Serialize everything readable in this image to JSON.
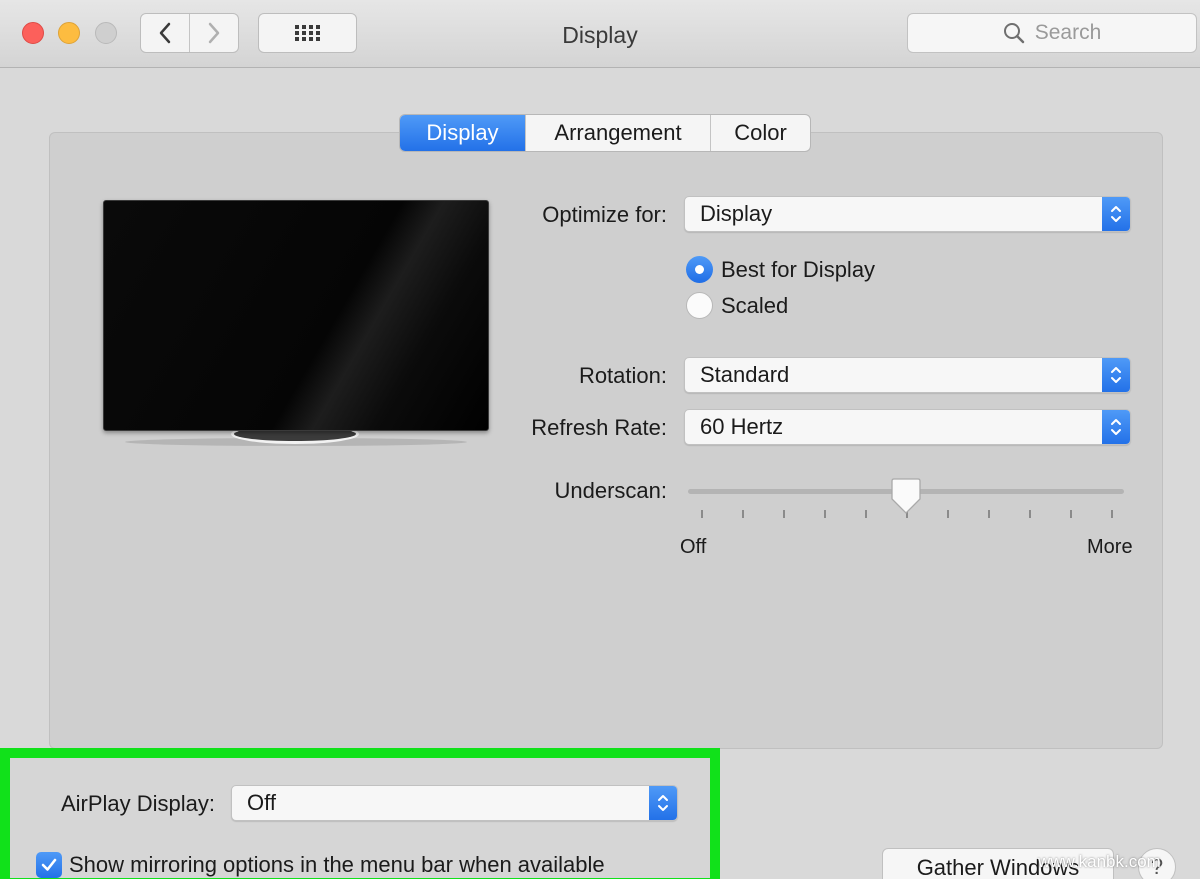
{
  "window": {
    "title": "Display"
  },
  "toolbar": {
    "search_placeholder": "Search",
    "back_icon": "chevron-left-icon",
    "forward_icon": "chevron-right-icon",
    "grid_icon": "show-all-grid-icon"
  },
  "tabs": [
    {
      "label": "Display",
      "active": true
    },
    {
      "label": "Arrangement",
      "active": false
    },
    {
      "label": "Color",
      "active": false
    }
  ],
  "settings": {
    "optimize_label": "Optimize for:",
    "optimize_value": "Display",
    "resolution_options": [
      {
        "label": "Best for Display",
        "selected": true
      },
      {
        "label": "Scaled",
        "selected": false
      }
    ],
    "rotation_label": "Rotation:",
    "rotation_value": "Standard",
    "refresh_label": "Refresh Rate:",
    "refresh_value": "60 Hertz",
    "underscan_label": "Underscan:",
    "underscan_min_label": "Off",
    "underscan_max_label": "More",
    "underscan_level": 0.5
  },
  "airplay": {
    "label": "AirPlay Display:",
    "value": "Off",
    "mirroring_checkbox_label": "Show mirroring options in the menu bar when available",
    "mirroring_checked": true
  },
  "footer": {
    "gather_button": "Gather Windows",
    "help_button": "?"
  },
  "watermark": "www.kanbk.com",
  "colors": {
    "accent": "#2f80ed",
    "highlight_border": "#11e11a"
  }
}
